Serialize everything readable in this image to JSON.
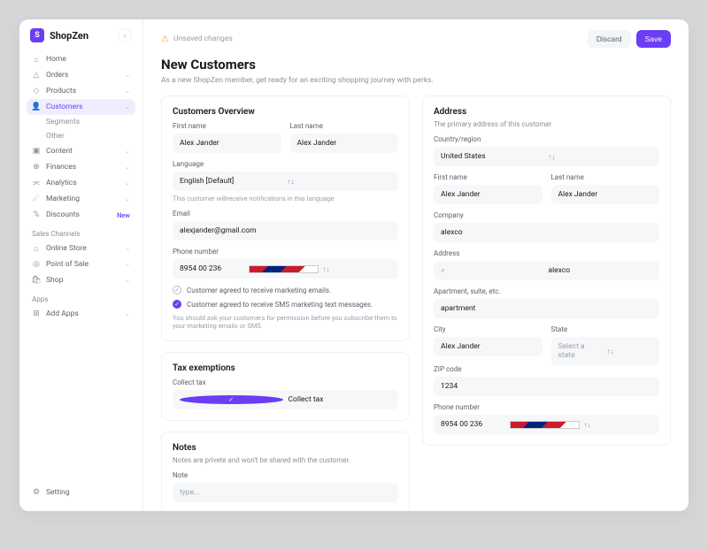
{
  "brand": {
    "logo_letter": "S",
    "name": "ShopZen"
  },
  "sidebar": {
    "items": [
      {
        "label": "Home",
        "icon": "⌂"
      },
      {
        "label": "Orders",
        "icon": "△"
      },
      {
        "label": "Products",
        "icon": "◇"
      },
      {
        "label": "Customers",
        "icon": "👤",
        "active": true
      },
      {
        "label": "Content",
        "icon": "▣"
      },
      {
        "label": "Finances",
        "icon": "⊕"
      },
      {
        "label": "Analytics",
        "icon": "⫘"
      },
      {
        "label": "Marketing",
        "icon": "☄"
      },
      {
        "label": "Discounts",
        "icon": "%"
      }
    ],
    "customers_sub": [
      {
        "label": "Segments"
      },
      {
        "label": "Other"
      }
    ],
    "discounts_badge": "New",
    "section_channels": "Sales Channels",
    "channels": [
      {
        "label": "Online Store",
        "icon": "⌂"
      },
      {
        "label": "Point of Sale",
        "icon": "◎"
      },
      {
        "label": "Shop",
        "icon": "🛍"
      }
    ],
    "section_apps": "Apps",
    "apps": [
      {
        "label": "Add Apps",
        "icon": "⊞"
      }
    ],
    "footer": {
      "label": "Setting",
      "icon": "⚙"
    }
  },
  "topbar": {
    "unsaved_label": "Unsaved changes",
    "discard_label": "Discard",
    "save_label": "Save"
  },
  "page": {
    "title": "New Customers",
    "subtitle": "As a new ShopZen member, get ready for an exciting shopping journey with perks."
  },
  "overview": {
    "card_title": "Customers Overview",
    "first_name_label": "First name",
    "first_name_value": "Alex Jander",
    "last_name_label": "Last name",
    "last_name_value": "Alex Jander",
    "language_label": "Language",
    "language_value": "English [Default]",
    "language_hint": "This customer willreceive notifications in this language",
    "email_label": "Email",
    "email_value": "alexjander@gmail.com",
    "phone_label": "Phone number",
    "phone_value": "8954 00 236",
    "consent_email": "Customer agreed to receive marketing emails.",
    "consent_sms": "Customer agreed to receive SMS marketing text messages.",
    "consent_hint": "You should ask your customers for permission before you subscribe them to your marketing emails or SMS."
  },
  "tax": {
    "card_title": "Tax exemptions",
    "collect_label": "Collect tax",
    "collect_value": "Collect tax"
  },
  "notes": {
    "card_title": "Notes",
    "card_sub": "Notes are privete and won't be shared with the customer.",
    "note_label": "Note",
    "note_placeholder": "type..."
  },
  "address": {
    "card_title": "Address",
    "card_sub": "The primary address of this customer",
    "country_label": "Country/region",
    "country_value": "United States",
    "first_name_label": "First name",
    "first_name_value": "Alex Jander",
    "last_name_label": "Last name",
    "last_name_value": "Alex Jander",
    "company_label": "Company",
    "company_value": "alexco",
    "address_label": "Address",
    "address_value": "alexco",
    "apt_label": "Apartment, suite, etc.",
    "apt_value": "apartment",
    "city_label": "City",
    "city_value": "Alex Jander",
    "state_label": "State",
    "state_value": "Select a state",
    "zip_label": "ZIP code",
    "zip_value": "1234",
    "phone_label": "Phone number",
    "phone_value": "8954 00 236"
  }
}
